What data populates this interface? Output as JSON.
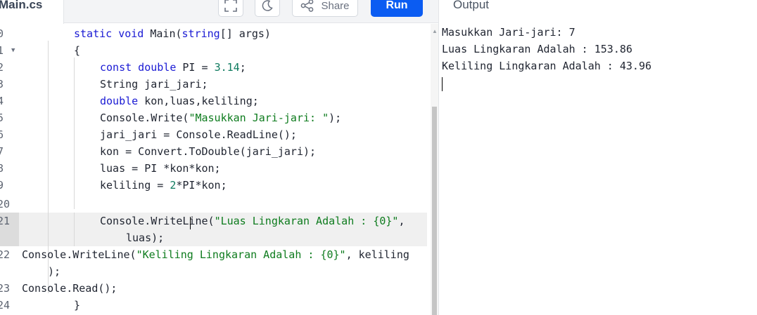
{
  "tabs": {
    "file_name": "Main.cs",
    "output_title": "Output"
  },
  "toolbar": {
    "fullscreen_icon": "fullscreen-icon",
    "theme_icon": "moon-icon",
    "share_label": "Share",
    "share_icon": "share-icon",
    "run_label": "Run",
    "run_color": "#0b5cf2"
  },
  "editor": {
    "lines": [
      {
        "num": "0",
        "text": "static void Main(string[] args)"
      },
      {
        "num": "1",
        "text": "{"
      },
      {
        "num": "2",
        "text": "const double PI = 3.14;"
      },
      {
        "num": "3",
        "text": "String jari_jari;"
      },
      {
        "num": "4",
        "text": "double kon,luas,keliling;"
      },
      {
        "num": "5",
        "text": "Console.Write(\"Masukkan Jari-jari: \");"
      },
      {
        "num": "6",
        "text": "jari_jari = Console.ReadLine();"
      },
      {
        "num": "7",
        "text": "kon = Convert.ToDouble(jari_jari);"
      },
      {
        "num": "8",
        "text": "luas = PI *kon*kon;"
      },
      {
        "num": "9",
        "text": "keliling = 2*PI*kon;"
      },
      {
        "num": "20",
        "text": ""
      },
      {
        "num": "21",
        "text": "Console.WriteLine(\"Luas Lingkaran Adalah : {0}\","
      },
      {
        "num": "",
        "text": "luas);"
      },
      {
        "num": "22",
        "text": "Console.WriteLine(\"Keliling Lingkaran Adalah : {0}\", keliling"
      },
      {
        "num": "",
        "text": ");"
      },
      {
        "num": "23",
        "text": "Console.Read();"
      },
      {
        "num": "24",
        "text": "}"
      }
    ]
  },
  "output": {
    "lines": [
      "Masukkan Jari-jari: 7",
      "Luas Lingkaran Adalah : 153.86",
      "Keliling Lingkaran Adalah : 43.96"
    ]
  }
}
